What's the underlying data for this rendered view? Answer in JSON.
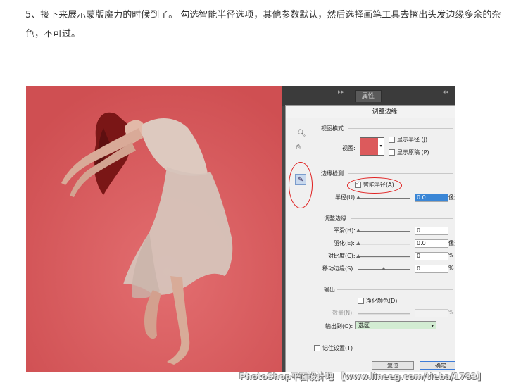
{
  "article": {
    "paragraph": "5、接下来展示蒙版魔力的时候到了。 勾选智能半径选项，其他参数默认，然后选择画笔工具去擦出头发边缘多余的杂色，不可过。"
  },
  "photoshop": {
    "panel_tab": "属性",
    "arrows_left": "▸▸",
    "arrows_right": "◂◂",
    "colors": {
      "photo_background": "#dc5a5c",
      "panel_dark": "#474747",
      "dialog_bg": "#f0f0f0",
      "highlight_oval": "#e02020"
    }
  },
  "dialog": {
    "title": "调整边缘",
    "view_mode": {
      "heading": "视图模式",
      "view_label": "视图:",
      "show_radius": "显示半径 (J)",
      "show_original": "显示原稿 (P)"
    },
    "edge_detection": {
      "heading": "边缘检测",
      "smart_radius": "智能半径(A)",
      "smart_radius_checked": true,
      "radius_label": "半径(U):",
      "radius_value": "0.0",
      "radius_unit": "像素"
    },
    "adjust_edge": {
      "heading": "调整边缘",
      "smooth_label": "平滑(H):",
      "smooth_value": "0",
      "feather_label": "羽化(E):",
      "feather_value": "0.0",
      "feather_unit": "像素",
      "contrast_label": "对比度(C):",
      "contrast_value": "0",
      "contrast_unit": "%",
      "shift_edge_label": "移动边缘(S):",
      "shift_edge_value": "0",
      "shift_edge_unit": "%"
    },
    "output": {
      "heading": "输出",
      "decontaminate": "净化颜色(D)",
      "amount_label": "数量(N):",
      "amount_unit": "%",
      "output_to_label": "输出到(O):",
      "output_to_value": "选区"
    },
    "remember_settings": "记住设置(T)",
    "reset_button": "复位",
    "ok_button": "确定"
  },
  "watermark": "PhotoShop平面设计吧 【www.lineeg.com/tieba/1783】"
}
